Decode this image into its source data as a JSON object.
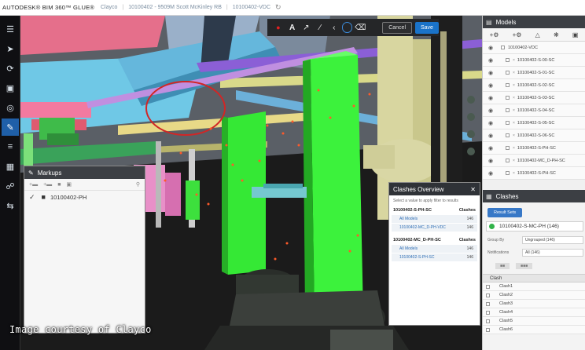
{
  "header": {
    "brand": "AUTODESK® BIM 360™ GLUE®",
    "crumbs": [
      "Clayco",
      "10100402 - 9509M Scott McKinley RB",
      "10100402-VDC"
    ],
    "refresh_icon": "refresh-icon"
  },
  "markup_toolbar": {
    "tools": [
      "record-dot-icon",
      "text-tool-icon",
      "arrow-tool-icon",
      "line-tool-icon",
      "chevron-tool-icon",
      "circle-tool-icon",
      "eraser-icon"
    ],
    "cancel_label": "Cancel",
    "save_label": "Save"
  },
  "left_toolbar": {
    "tools": [
      "model-tree-icon",
      "select-icon",
      "orbit-icon",
      "cube-icon",
      "view-icon",
      "markup-icon",
      "list-icon",
      "clash-icon",
      "attach-icon",
      "swap-icon"
    ],
    "active_index": 5
  },
  "markups_panel": {
    "title": "Markups",
    "tools": [
      "add-icon",
      "folder-add-icon",
      "folder-icon",
      "delete-icon",
      "search-icon"
    ],
    "items": [
      {
        "checked": true,
        "label": "10100402-PH"
      }
    ]
  },
  "clashes_overview": {
    "title": "Clashes Overview",
    "hint": "Select a value to apply filter to results",
    "groups": [
      {
        "name": "10100402-S-PH-SC",
        "count_label": "Clashes",
        "items": [
          {
            "label": "All Models",
            "count": "146"
          },
          {
            "label": "10100402-MC_D-PH-VDC",
            "count": "146"
          }
        ]
      },
      {
        "name": "10100402-MC_D-PH-SC",
        "count_label": "Clashes",
        "items": [
          {
            "label": "All Models",
            "count": "146"
          },
          {
            "label": "10100402-S-PH-SC",
            "count": "146"
          }
        ]
      }
    ]
  },
  "models_panel": {
    "title": "Models",
    "tools": [
      "add-model-icon",
      "merge-icon",
      "star-icon",
      "settings-icon",
      "delete-icon"
    ],
    "root": "10100402-VDC",
    "items": [
      "10100402-S-00-SC",
      "10100402-S-01-SC",
      "10100402-S-02-SC",
      "10100402-S-03-SC",
      "10100402-S-04-SC",
      "10100402-S-05-SC",
      "10100402-S-06-SC",
      "10100402-S-PH-SC",
      "10100402-MC_D-PH-SC",
      "10100402-S-PH-SC"
    ]
  },
  "clashes_panel": {
    "title": "Clashes",
    "result_button": "Result Sets",
    "selected": "10100402-S-MC-PH (146)",
    "status_color": "#32b34a",
    "group_by_label": "Group By",
    "group_by_value": "Ungrouped (146)",
    "notifications_label": "Notifications",
    "notifications_value": "All (146)",
    "list_header": "Clash",
    "rows": [
      "Clash1",
      "Clash2",
      "Clash3",
      "Clash4",
      "Clash5",
      "Clash6"
    ]
  },
  "credit": "Image courtesy of Clayco"
}
